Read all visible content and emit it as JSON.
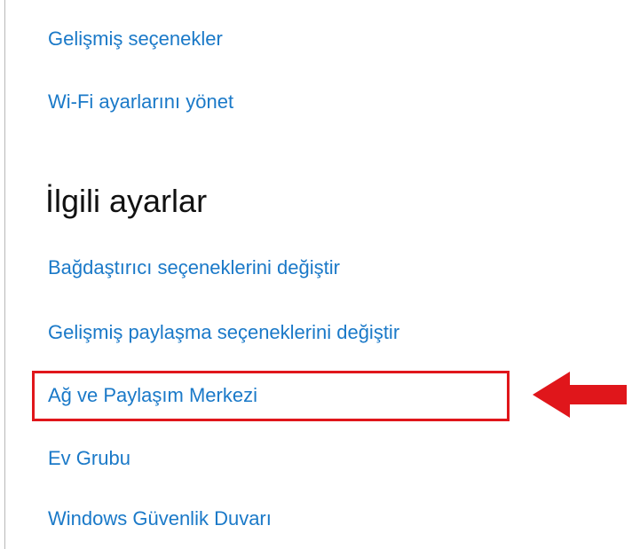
{
  "links_top": [
    {
      "label": "Gelişmiş seçenekler"
    },
    {
      "label": "Wi-Fi ayarlarını yönet"
    }
  ],
  "related_settings": {
    "heading": "İlgili ayarlar",
    "items": [
      {
        "label": "Bağdaştırıcı seçeneklerini değiştir"
      },
      {
        "label": "Gelişmiş paylaşma seçeneklerini değiştir"
      },
      {
        "label": "Ağ ve Paylaşım Merkezi"
      },
      {
        "label": "Ev Grubu"
      },
      {
        "label": "Windows Güvenlik Duvarı"
      }
    ]
  },
  "colors": {
    "link": "#1a79c8",
    "heading": "#111111",
    "highlight": "#e0161b"
  },
  "icons": {
    "callout_arrow": "red-left-arrow-icon"
  }
}
